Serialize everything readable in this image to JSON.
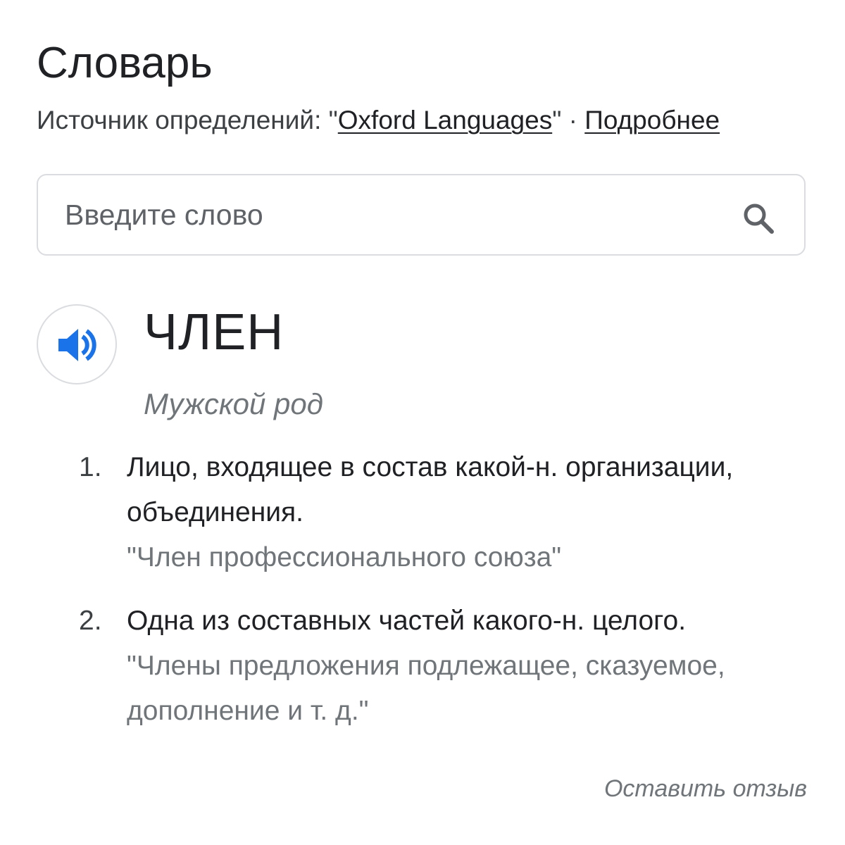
{
  "header": {
    "title": "Словарь",
    "source_prefix": "Источник определений: \"",
    "source_link": "Oxford Languages",
    "source_suffix": "\" · ",
    "more_link": "Подробнее"
  },
  "search": {
    "placeholder": "Введите слово",
    "value": "",
    "icon": "search-icon"
  },
  "entry": {
    "audio_icon": "speaker-icon",
    "accent_color": "#1a73e8",
    "word": "ЧЛЕН",
    "gender": "Мужской род",
    "definitions": [
      {
        "number": "1.",
        "text": "Лицо, входящее в состав какой-н. организации, объединения.",
        "example": "\"Член профессионального союза\""
      },
      {
        "number": "2.",
        "text": "Одна из составных частей какого-н. целого.",
        "example": "\"Члены предложения подлежащее, сказуемое, дополнение и т. д.\""
      }
    ]
  },
  "footer": {
    "feedback": "Оставить отзыв"
  }
}
